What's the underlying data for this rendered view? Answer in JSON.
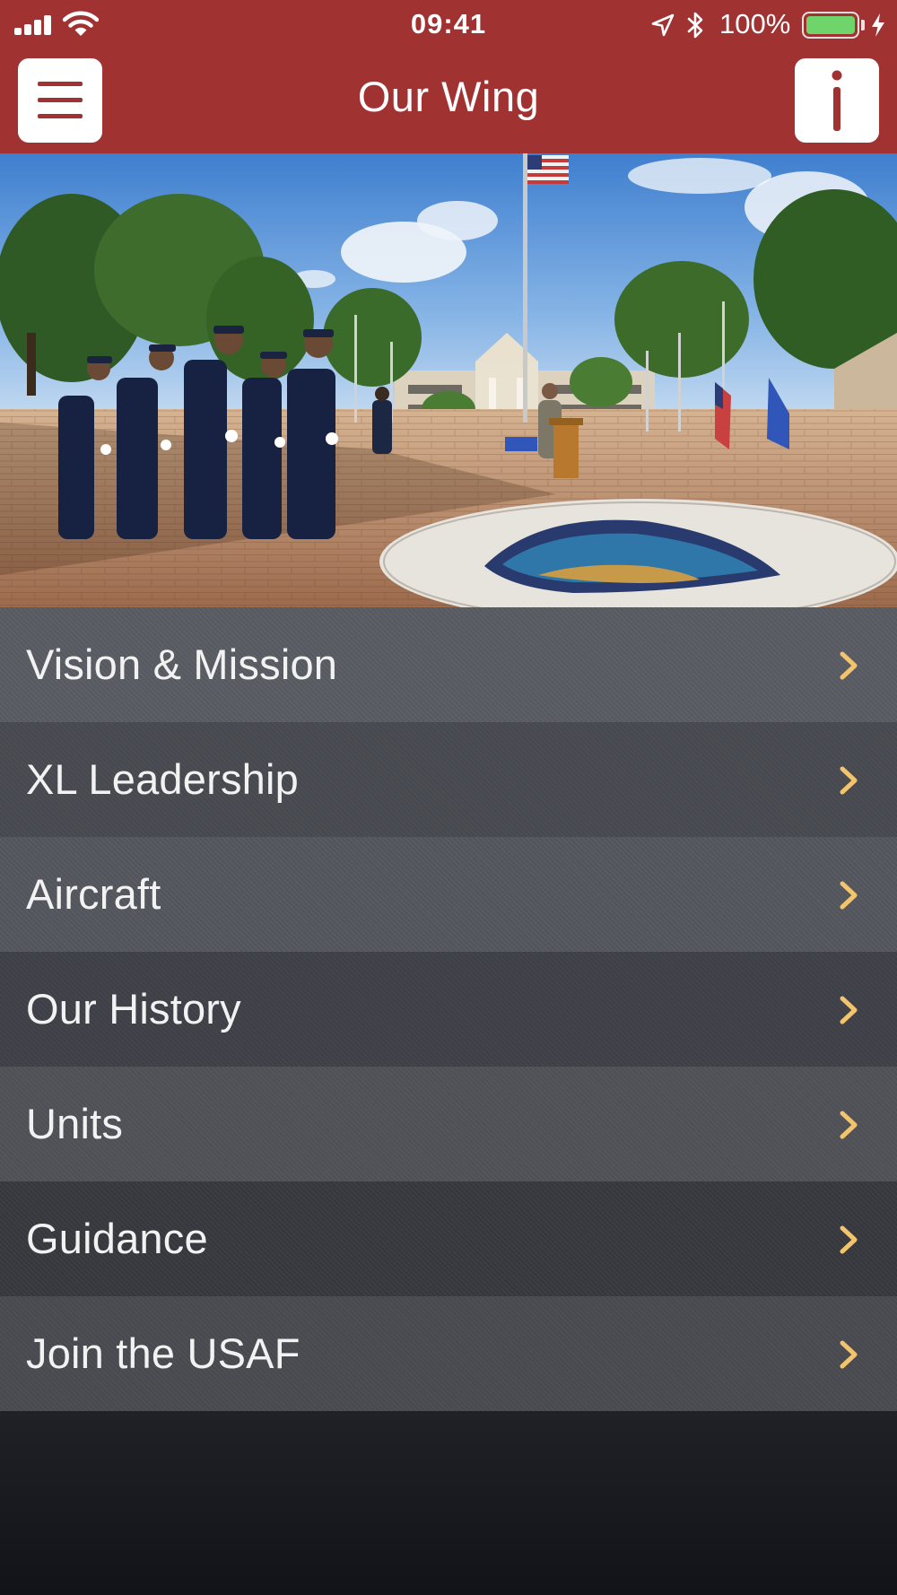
{
  "status_bar": {
    "time": "09:41",
    "battery_percent": "100%",
    "battery_level": 1.0,
    "battery_color": "#6fd46a",
    "icons": [
      "cellular-signal-icon",
      "wifi-icon",
      "location-arrow-icon",
      "bluetooth-icon",
      "battery-icon",
      "charging-bolt-icon"
    ]
  },
  "nav": {
    "title": "Our Wing",
    "menu_icon": "hamburger-menu-icon",
    "info_icon": "info-icon",
    "bar_color": "#a13232"
  },
  "hero": {
    "image": "honor-guard-ceremony-photo"
  },
  "menu": {
    "chevron_icon": "chevron-right-icon",
    "chevron_color": "#f3c46b",
    "items": [
      {
        "label": "Vision & Mission",
        "color": "#5a5c63"
      },
      {
        "label": "XL Leadership",
        "color": "#484a51"
      },
      {
        "label": "Aircraft",
        "color": "#55575e"
      },
      {
        "label": "Our History",
        "color": "#3f4148"
      },
      {
        "label": "Units",
        "color": "#505258"
      },
      {
        "label": "Guidance",
        "color": "#38393f"
      },
      {
        "label": "Join the USAF",
        "color": "#494b51"
      }
    ]
  }
}
